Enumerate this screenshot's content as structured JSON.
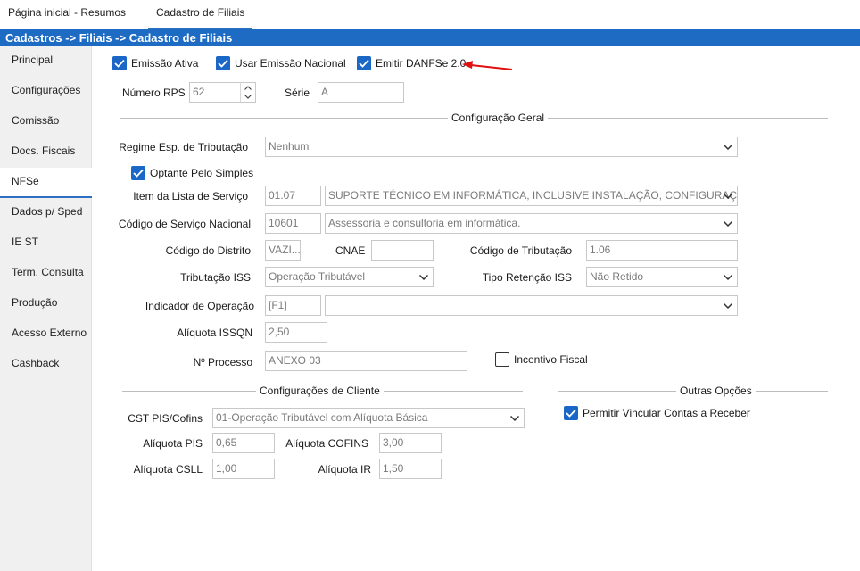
{
  "tabs": [
    {
      "label": "Página inicial - Resumos"
    },
    {
      "label": "Cadastro de Filiais"
    }
  ],
  "breadcrumb": "Cadastros -> Filiais -> Cadastro de Filiais",
  "sidebar": {
    "items": [
      {
        "label": "Principal"
      },
      {
        "label": "Configurações"
      },
      {
        "label": "Comissão"
      },
      {
        "label": "Docs. Fiscais"
      },
      {
        "label": "NFSe"
      },
      {
        "label": "Dados p/ Sped"
      },
      {
        "label": "IE ST"
      },
      {
        "label": "Term. Consulta"
      },
      {
        "label": "Produção"
      },
      {
        "label": "Acesso Externo"
      },
      {
        "label": "Cashback"
      }
    ],
    "active": "NFSe"
  },
  "options": {
    "emissao_ativa": {
      "label": "Emissão Ativa",
      "checked": true
    },
    "usar_emissao_nacional": {
      "label": "Usar Emissão Nacional",
      "checked": true
    },
    "emitir_danfse": {
      "label": "Emitir DANFSe 2.0",
      "checked": true
    }
  },
  "numero_rps": {
    "label": "Número RPS",
    "value": "62"
  },
  "serie": {
    "label": "Série",
    "value": "A"
  },
  "config_geral": {
    "title": "Configuração Geral",
    "regime": {
      "label": "Regime Esp. de Tributação",
      "value": "Nenhum"
    },
    "optante_simples": {
      "label": "Optante Pelo Simples",
      "checked": true
    },
    "item_lista": {
      "label": "Item da Lista de Serviço",
      "code": "01.07",
      "value": "SUPORTE TÉCNICO EM INFORMÁTICA, INCLUSIVE INSTALAÇÃO, CONFIGURAÇÃO E MA"
    },
    "codigo_servico_nacional": {
      "label": "Código de Serviço Nacional",
      "code": "10601",
      "value": "Assessoria e consultoria em informática."
    },
    "codigo_distrito": {
      "label": "Código do Distrito",
      "value": "VAZI..."
    },
    "cnae": {
      "label": "CNAE",
      "value": ""
    },
    "codigo_tributacao": {
      "label": "Código de Tributação",
      "value": "1.06"
    },
    "tributacao_iss": {
      "label": "Tributação ISS",
      "value": "Operação Tributável"
    },
    "tipo_retencao_iss": {
      "label": "Tipo Retenção ISS",
      "value": "Não Retido"
    },
    "indicador_operacao": {
      "label": "Indicador de Operação",
      "code": "[F1]",
      "value": ""
    },
    "aliquota_issqn": {
      "label": "Alíquota ISSQN",
      "value": "2,50"
    },
    "numero_processo": {
      "label": "Nº Processo",
      "value": "ANEXO 03"
    },
    "incentivo_fiscal": {
      "label": "Incentivo Fiscal",
      "checked": false
    }
  },
  "config_cliente": {
    "title": "Configurações de Cliente",
    "cst_pis_cofins": {
      "label": "CST PIS/Cofins",
      "value": "01-Operação Tributável com Alíquota Básica"
    },
    "aliquota_pis": {
      "label": "Alíquota PIS",
      "value": "0,65"
    },
    "aliquota_cofins": {
      "label": "Alíquota COFINS",
      "value": "3,00"
    },
    "aliquota_csll": {
      "label": "Alíquota CSLL",
      "value": "1,00"
    },
    "aliquota_ir": {
      "label": "Alíquota IR",
      "value": "1,50"
    }
  },
  "outras_opcoes": {
    "title": "Outras Opções",
    "permitir_vincular": {
      "label": "Permitir Vincular Contas a Receber",
      "checked": true
    }
  },
  "icons": {
    "combo_arrow": "chevron-down-icon",
    "checkbox_check": "check-icon",
    "annotation": "red-arrow-icon"
  },
  "colors": {
    "accent": "#1e6bc4",
    "checkbox": "#1a67c8",
    "annotation": "#e01010"
  }
}
